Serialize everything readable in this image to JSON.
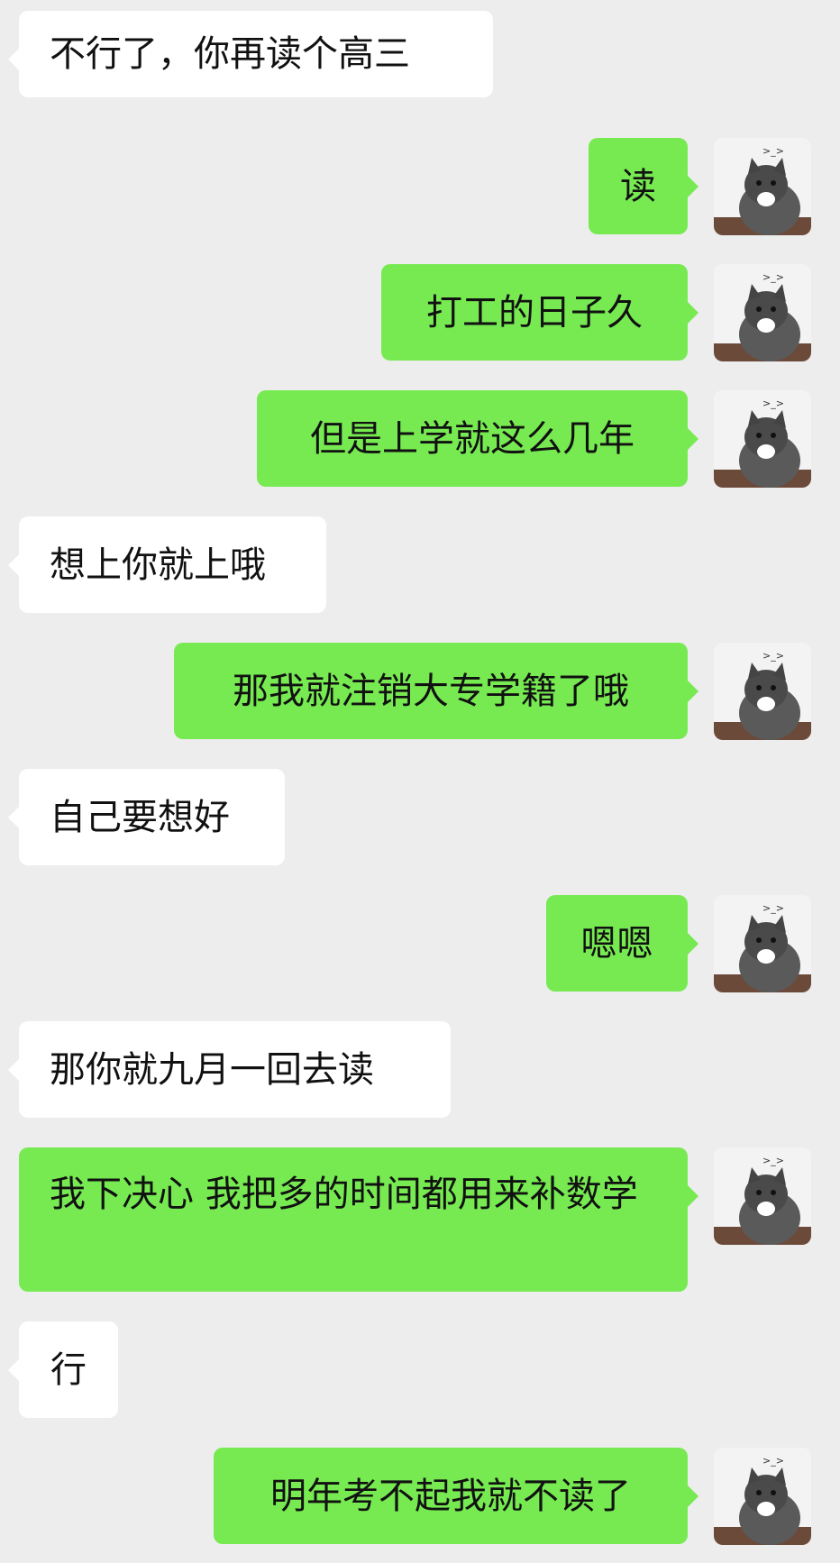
{
  "messages": [
    {
      "side": "left",
      "text": "不行了，你再读个高三"
    },
    {
      "side": "right",
      "text": "读",
      "avatar": "cat-avatar-icon"
    },
    {
      "side": "right",
      "text": "打工的日子久",
      "avatar": "cat-avatar-icon"
    },
    {
      "side": "right",
      "text": "但是上学就这么几年",
      "avatar": "cat-avatar-icon"
    },
    {
      "side": "left",
      "text": "想上你就上哦"
    },
    {
      "side": "right",
      "text": "那我就注销大专学籍了哦",
      "avatar": "cat-avatar-icon"
    },
    {
      "side": "left",
      "text": "自己要想好"
    },
    {
      "side": "right",
      "text": "嗯嗯",
      "avatar": "cat-avatar-icon"
    },
    {
      "side": "left",
      "text": "那你就九月一回去读"
    },
    {
      "side": "right",
      "text": "我下决心 我把多的时间都用来补数学",
      "avatar": "cat-avatar-icon"
    },
    {
      "side": "left",
      "text": "行"
    },
    {
      "side": "right",
      "text": "明年考不起我就不读了",
      "avatar": "cat-avatar-icon"
    }
  ],
  "colors": {
    "background": "#ededed",
    "incoming_bubble": "#ffffff",
    "outgoing_bubble": "#77ea52",
    "text": "#111111"
  }
}
